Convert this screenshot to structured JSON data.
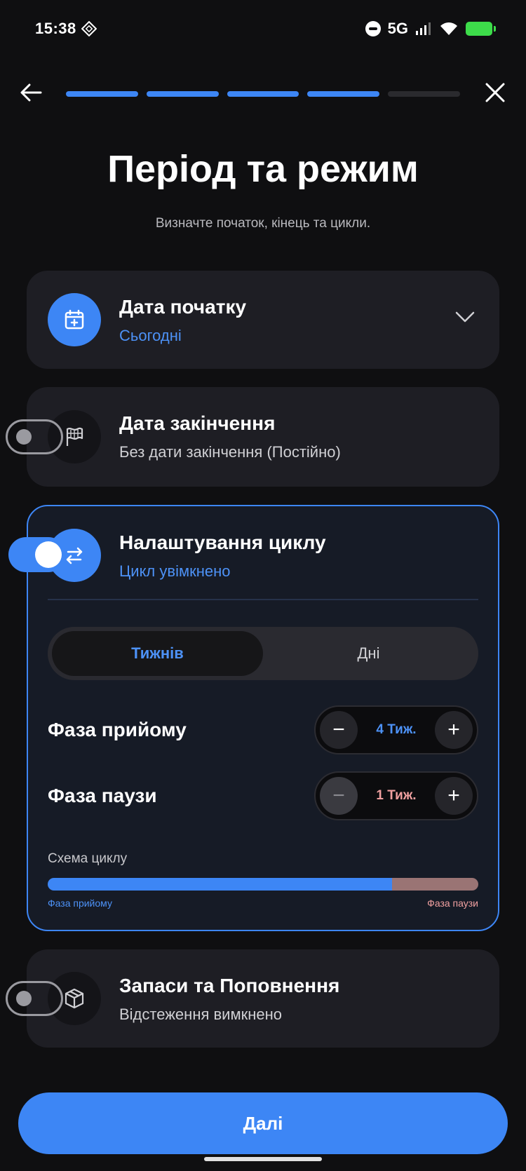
{
  "status_bar": {
    "time": "15:38",
    "network": "5G",
    "icons": [
      "diamond-app-icon",
      "do-not-disturb-icon",
      "signal-icon",
      "wifi-icon",
      "battery-charging-icon"
    ]
  },
  "header": {
    "progress_total": 5,
    "progress_completed": 4
  },
  "title": "Період та режим",
  "subtitle": "Визначте початок, кінець та цикли.",
  "start_date": {
    "title": "Дата початку",
    "value": "Сьогодні",
    "icon": "calendar-plus-icon"
  },
  "end_date": {
    "title": "Дата закінчення",
    "value": "Без дати закінчення (Постійно)",
    "icon": "flag-icon",
    "enabled": false
  },
  "cycle": {
    "title": "Налаштування циклу",
    "status": "Цикл увімкнено",
    "icon": "swap-arrows-icon",
    "enabled": true,
    "tabs": [
      "Тижнів",
      "Дні"
    ],
    "selected_tab": "Тижнів",
    "intake": {
      "label": "Фаза прийому",
      "value": "4 Тиж.",
      "weeks": 4
    },
    "pause": {
      "label": "Фаза паузи",
      "value": "1 Тиж.",
      "weeks": 1
    },
    "scheme": {
      "title": "Схема циклу",
      "intake_label": "Фаза прийому",
      "pause_label": "Фаза паузи"
    }
  },
  "supplies": {
    "title": "Запаси та Поповнення",
    "status": "Відстеження вимкнено",
    "icon": "box-icon",
    "enabled": false
  },
  "next_button": "Далі",
  "colors": {
    "accent": "#3d86f5",
    "background": "#0f0f11",
    "card": "#1e1e24",
    "pause_phase": "#9a7474",
    "pause_text": "#f0a0a0"
  }
}
